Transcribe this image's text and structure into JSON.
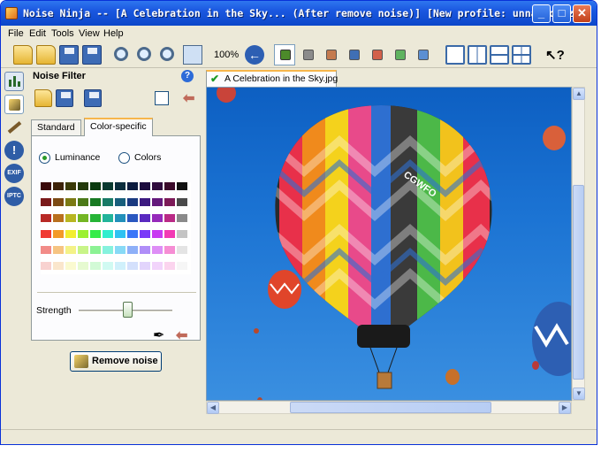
{
  "window": {
    "title": "Noise Ninja -- [A Celebration in the Sky... (After remove noise)] [New profile: unnamed.nzp]",
    "minimize": "_",
    "maximize": "□",
    "close": "✕"
  },
  "menu": [
    "File",
    "Edit",
    "Tools",
    "View",
    "Help"
  ],
  "toolbar": {
    "zoom": "100%",
    "icons": [
      "open-folder-icon",
      "open-folder-icon",
      "save-icon",
      "save-as-icon",
      "zoom-in-icon",
      "zoom-out-icon",
      "zoom-icon",
      "fit-icon",
      "back-arrow-icon",
      "channel-view-icon",
      "view-single-icon",
      "view-split-vertical-icon",
      "view-split-horizontal-icon",
      "view-quad-icon",
      "help-cursor-icon"
    ],
    "channel_colors": [
      "#7e7e3a",
      "#8b8b8b",
      "#c47a4e",
      "#3f6fb5",
      "#d2604a",
      "#5fb35f",
      "#5c8fd2"
    ]
  },
  "side_icons": [
    "histogram-icon",
    "noise-filter-icon",
    "brush-icon",
    "warning-icon",
    "EXIF",
    "IPTC"
  ],
  "panel": {
    "title": "Noise Filter",
    "help": "?",
    "tabs": [
      "Standard",
      "Color-specific"
    ],
    "radio_luminance": "Luminance",
    "radio_colors": "Colors",
    "strength_label": "Strength",
    "strength_value": 0.5,
    "remove_button": "Remove noise"
  },
  "palette": [
    [
      "#3a0a0a",
      "#3d2208",
      "#3b3a08",
      "#23390b",
      "#0b3a0f",
      "#0a3a30",
      "#0b2d3d",
      "#0c1b3e",
      "#1c0c3e",
      "#2f0b3c",
      "#3b0a2a",
      "#111111"
    ],
    [
      "#7a1a1a",
      "#7c4a14",
      "#7b7a14",
      "#4c7a18",
      "#187a22",
      "#187a66",
      "#185f7c",
      "#1a3a80",
      "#3c1a80",
      "#641a7c",
      "#7c1a58",
      "#4a4a4a"
    ],
    [
      "#b82a26",
      "#b9701e",
      "#b8b622",
      "#74b624",
      "#26b436",
      "#22b49a",
      "#2290ba",
      "#2a58c0",
      "#5a2ac0",
      "#962aba",
      "#ba2a86",
      "#8a8a8a"
    ],
    [
      "#f03a32",
      "#f39a28",
      "#f2ee30",
      "#9cf032",
      "#34ec4a",
      "#30eece",
      "#30c2f2",
      "#3a76f8",
      "#7a3af8",
      "#c83af2",
      "#f23ab4",
      "#c4c4c4"
    ],
    [
      "#f28c88",
      "#f6c482",
      "#f4f288",
      "#c8f488",
      "#8cf294",
      "#86f2de",
      "#88daf6",
      "#8eb0f8",
      "#b08ef8",
      "#de8ef6",
      "#f68ed4",
      "#e4e4e4"
    ],
    [
      "#f8d2d0",
      "#fae6cc",
      "#fafad0",
      "#e6fad0",
      "#d2fad6",
      "#d0faf2",
      "#d0f0fb",
      "#d4e0fc",
      "#e2d4fc",
      "#f2d4fb",
      "#fbd4ee",
      "#f6f6f6"
    ]
  ],
  "document": {
    "tab_label": "A Celebration in the Sky.jpg",
    "balloon_text": "CGWFO"
  }
}
